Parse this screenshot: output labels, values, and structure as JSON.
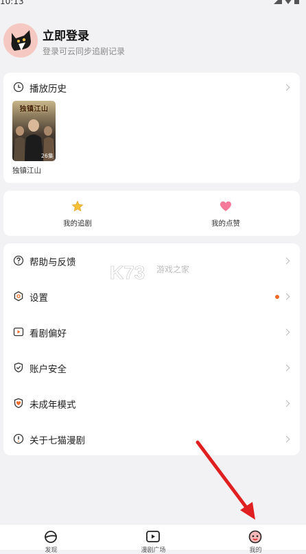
{
  "status": {
    "time": "10:13"
  },
  "profile": {
    "title": "立即登录",
    "subtitle": "登录可云同步追剧记录"
  },
  "history": {
    "title": "播放历史",
    "items": [
      {
        "poster_text": "独镇江山",
        "episodes": "26集",
        "name": "独镇江山"
      }
    ]
  },
  "quick": {
    "follow_label": "我的追剧",
    "likes_label": "我的点赞"
  },
  "menu": {
    "items": [
      {
        "label": "帮助与反馈",
        "icon": "help-icon"
      },
      {
        "label": "设置",
        "icon": "settings-icon"
      },
      {
        "label": "看剧偏好",
        "icon": "play-preference-icon"
      },
      {
        "label": "账户安全",
        "icon": "shield-icon"
      },
      {
        "label": "未成年模式",
        "icon": "minor-mode-icon"
      },
      {
        "label": "关于七猫漫剧",
        "icon": "info-icon"
      }
    ]
  },
  "watermark": {
    "text": "K73",
    "sub": "游戏之家"
  },
  "tabs": [
    {
      "label": "发现",
      "icon": "discover-icon"
    },
    {
      "label": "漫剧广场",
      "icon": "video-play-icon"
    },
    {
      "label": "我的",
      "icon": "profile-icon"
    }
  ],
  "colors": {
    "accent": "#f06a28",
    "background": "#f2f2f4",
    "arrow": "#e02020"
  }
}
